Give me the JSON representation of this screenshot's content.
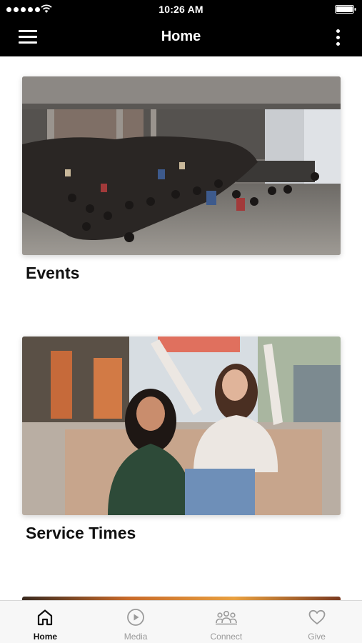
{
  "status_bar": {
    "time": "10:26 AM"
  },
  "nav": {
    "title": "Home"
  },
  "cards": [
    {
      "title": "Events"
    },
    {
      "title": "Service Times"
    }
  ],
  "tabs": [
    {
      "label": "Home",
      "icon": "home-icon",
      "active": true
    },
    {
      "label": "Media",
      "icon": "play-circle-icon",
      "active": false
    },
    {
      "label": "Connect",
      "icon": "people-icon",
      "active": false
    },
    {
      "label": "Give",
      "icon": "heart-icon",
      "active": false
    }
  ],
  "colors": {
    "bar_background": "#000000",
    "active_tab": "#111111",
    "inactive_tab": "#9a9a9a"
  }
}
